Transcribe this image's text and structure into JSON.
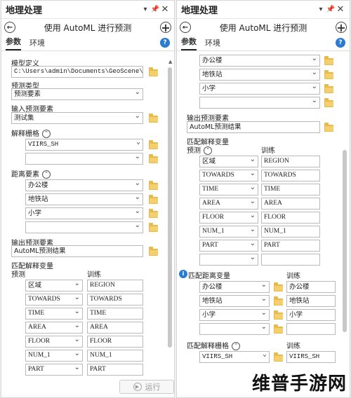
{
  "left": {
    "title": "地理处理",
    "tool_title": "使用 AutoML 进行预测",
    "tabs": [
      "参数",
      "环境"
    ],
    "model_label": "模型定义",
    "model_value": "C:\\Users\\admin\\Documents\\GeoScene\\",
    "pred_type_label": "预测类型",
    "pred_type_value": "预测要素",
    "input_label": "输入预测要素",
    "input_value": "测试集",
    "raster_label": "解释栅格",
    "raster_values": [
      "VIIRS_SH",
      ""
    ],
    "distance_label": "距离要素",
    "distance_values": [
      "办公楼",
      "地铁站",
      "小学",
      ""
    ],
    "output_label": "输出预测要素",
    "output_value": "AutoML预测结果",
    "match_label": "匹配解释变量",
    "pred_col": "预测",
    "train_col": "训练",
    "match_rows": [
      [
        "区域",
        "REGION"
      ],
      [
        "TOWARDS",
        "TOWARDS"
      ],
      [
        "TIME",
        "TIME"
      ],
      [
        "AREA",
        "AREA"
      ],
      [
        "FLOOR",
        "FLOOR"
      ],
      [
        "NUM_1",
        "NUM_1"
      ],
      [
        "PART",
        "PART"
      ]
    ],
    "run_label": "运行"
  },
  "right": {
    "title": "地理处理",
    "tool_title": "使用 AutoML 进行预测",
    "tabs": [
      "参数",
      "环境"
    ],
    "top_distance_values": [
      "办公楼",
      "地铁站",
      "小学",
      ""
    ],
    "output_label": "输出预测要素",
    "output_value": "AutoML预测结果",
    "match_label": "匹配解释变量",
    "pred_col": "预测",
    "train_col": "训练",
    "match_rows": [
      [
        "区域",
        "REGION"
      ],
      [
        "TOWARDS",
        "TOWARDS"
      ],
      [
        "TIME",
        "TIME"
      ],
      [
        "AREA",
        "AREA"
      ],
      [
        "FLOOR",
        "FLOOR"
      ],
      [
        "NUM_1",
        "NUM_1"
      ],
      [
        "PART",
        "PART"
      ],
      [
        "",
        ""
      ]
    ],
    "match_dist_label": "匹配距离变量",
    "match_dist_train_col": "训练",
    "match_dist_rows": [
      [
        "办公楼",
        "办公楼"
      ],
      [
        "地铁站",
        "地铁站"
      ],
      [
        "小学",
        "小学"
      ],
      [
        "",
        ""
      ]
    ],
    "match_raster_label": "匹配解释栅格",
    "match_raster_train_col": "训练",
    "match_raster_rows": [
      [
        "VIIRS_SH",
        "VIIRS_SH"
      ]
    ]
  },
  "watermark": "维普手游网"
}
